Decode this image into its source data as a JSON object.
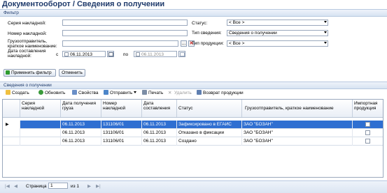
{
  "window": {
    "title": "Документооборот  / Сведения о получении"
  },
  "filter": {
    "section_title": "Фильтр",
    "series_label": "Серия накладной:",
    "number_label": "Номер накладной:",
    "shipper_label": "Грузоотправитель, краткое наименование:",
    "date_label": "Дата составления накладной:",
    "date_from_label": "с",
    "date_to_label": "по",
    "date_from": "06.11.2013",
    "date_to": "06.11.2013",
    "status_label": "Статус:",
    "status_value": "< Все >",
    "info_type_label": "Тип сведения:",
    "info_type_value": "Сведения о получении",
    "product_type_label": "Тип продукции:",
    "product_type_value": "< Все >",
    "browse_glyph": "...",
    "clear_glyph": "✕",
    "apply_label": "Применить фильтр",
    "cancel_label": "Отменить"
  },
  "receipts": {
    "section_title": "Сведения о получении",
    "toolbar": {
      "create": "Создать",
      "refresh": "Обновить",
      "properties": "Свойства",
      "send": "Отправить",
      "print": "Печать",
      "delete": "Удалить",
      "return_goods": "Возврат продукции"
    },
    "columns": [
      "Серия накладной",
      "Дата получения груза",
      "Номер накладной",
      "Дата составления",
      "Статус",
      "Грузоотправитель, краткое наименование",
      "Импортная продукция"
    ],
    "rows": [
      {
        "series": "",
        "received": "06.11.2013",
        "number": "131106/01",
        "created": "06.11.2013",
        "status": "Зафиксировано в ЕГАИС",
        "shipper": "ЗАО \"БОЗАН\"",
        "imported": false,
        "selected": true
      },
      {
        "series": "",
        "received": "06.11.2013",
        "number": "131106/01",
        "created": "06.11.2013",
        "status": "Отказано в фиксации",
        "shipper": "ЗАО \"БОЗАН\"",
        "imported": false,
        "selected": false
      },
      {
        "series": "",
        "received": "06.11.2013",
        "number": "131106/01",
        "created": "06.11.2013",
        "status": "Создано",
        "shipper": "ЗАО \"БОЗАН\"",
        "imported": false,
        "selected": false
      }
    ],
    "row_pointer": "▶"
  },
  "pager": {
    "page_label": "Страница",
    "page_value": "1",
    "of_label": "из 1",
    "first": "|◀",
    "prev": "◀",
    "next": "▶",
    "last": "▶|"
  }
}
